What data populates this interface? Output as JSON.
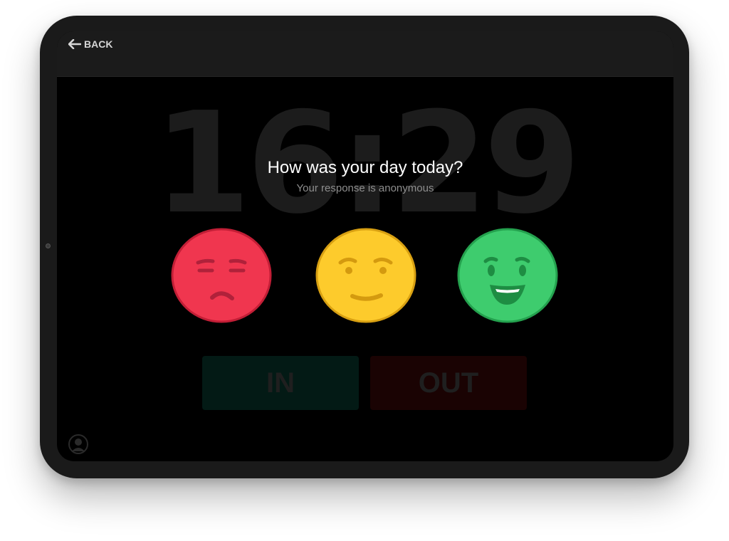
{
  "topbar": {
    "back_label": "BACK",
    "back_icon": "arrow-left-icon"
  },
  "clock": {
    "time": "16:29"
  },
  "prompt": {
    "question": "How was your day today?",
    "subtitle": "Your response is anonymous"
  },
  "moods": [
    {
      "id": "sad",
      "color": "#f0364f",
      "border": "#c21e36",
      "feature": "#b0213a"
    },
    {
      "id": "okay",
      "color": "#fdcb2c",
      "border": "#d8a012",
      "feature": "#d49a0f"
    },
    {
      "id": "happy",
      "color": "#3ecc6e",
      "border": "#24a14e",
      "feature": "#1e8d43"
    }
  ],
  "actions": {
    "in_label": "IN",
    "out_label": "OUT"
  },
  "profile": {
    "icon": "user-icon"
  }
}
